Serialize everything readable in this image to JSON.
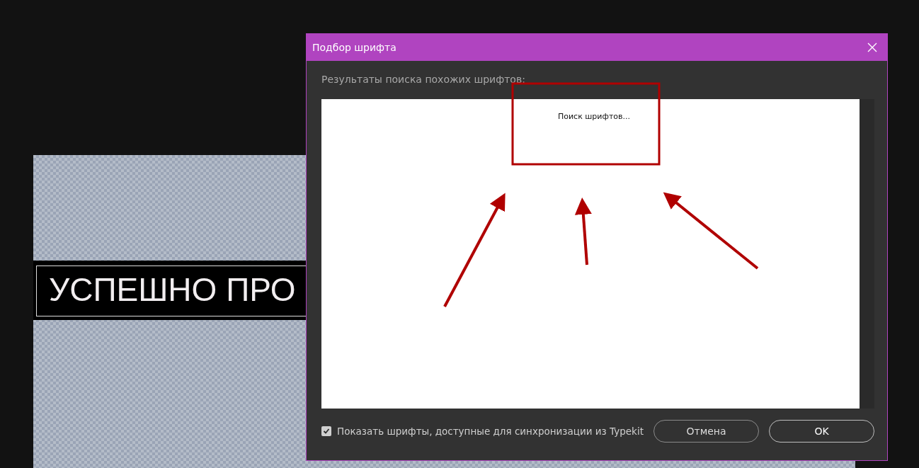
{
  "canvas": {
    "layer_text": "УСПЕШНО ПРО",
    "layer_selected": true
  },
  "dialog": {
    "title": "Подбор шрифта",
    "results_label": "Результаты поиска похожих шрифтов:",
    "results_status": "Поиск шрифтов...",
    "typekit_checkbox": {
      "label": "Показать шрифты, доступные для синхронизации из Typekit",
      "checked": true
    },
    "buttons": [
      {
        "label": "Отмена",
        "kind": "cancel"
      },
      {
        "label": "OK",
        "kind": "ok"
      }
    ]
  }
}
